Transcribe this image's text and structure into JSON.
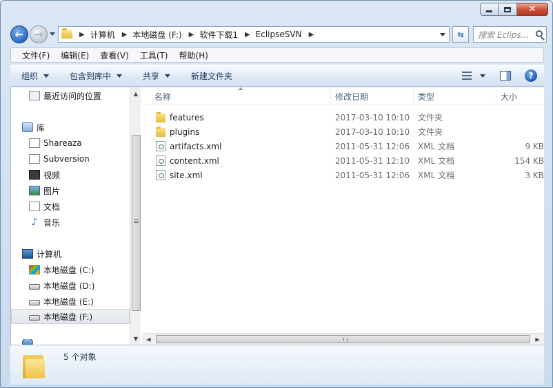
{
  "window": {
    "minimize_glyph": "minimize-icon",
    "maximize_glyph": "maximize-icon",
    "close_label": "✕"
  },
  "address_bar": {
    "crumbs": [
      "计算机",
      "本地磁盘 (F:)",
      "软件下载1",
      "EclipseSVN"
    ],
    "search_placeholder": "搜索 Eclips..."
  },
  "menu": [
    "文件(F)",
    "编辑(E)",
    "查看(V)",
    "工具(T)",
    "帮助(H)"
  ],
  "toolbar": {
    "organize": "组织",
    "include_in_library": "包含到库中",
    "share": "共享",
    "new_folder": "新建文件夹"
  },
  "sidebar": {
    "recent": "最近访问的位置",
    "libraries": "库",
    "library_items": [
      "Shareaza",
      "Subversion",
      "视频",
      "图片",
      "文档",
      "音乐"
    ],
    "computer": "计算机",
    "drives": [
      "本地磁盘 (C:)",
      "本地磁盘 (D:)",
      "本地磁盘 (E:)",
      "本地磁盘 (F:)"
    ],
    "selected_drive": "本地磁盘 (F:)"
  },
  "columns": {
    "name": "名称",
    "modified": "修改日期",
    "type": "类型",
    "size": "大小"
  },
  "files": [
    {
      "name": "features",
      "modified": "2017-03-10 10:10",
      "type": "文件夹",
      "size": "",
      "icon": "folder-icon"
    },
    {
      "name": "plugins",
      "modified": "2017-03-10 10:10",
      "type": "文件夹",
      "size": "",
      "icon": "folder-icon"
    },
    {
      "name": "artifacts.xml",
      "modified": "2011-05-31 12:06",
      "type": "XML 文档",
      "size": "9 KB",
      "icon": "xml-file-icon"
    },
    {
      "name": "content.xml",
      "modified": "2011-05-31 12:10",
      "type": "XML 文档",
      "size": "154 KB",
      "icon": "xml-file-icon"
    },
    {
      "name": "site.xml",
      "modified": "2011-05-31 12:06",
      "type": "XML 文档",
      "size": "3 KB",
      "icon": "xml-file-icon"
    }
  ],
  "status": {
    "count_text": "5 个对象"
  }
}
